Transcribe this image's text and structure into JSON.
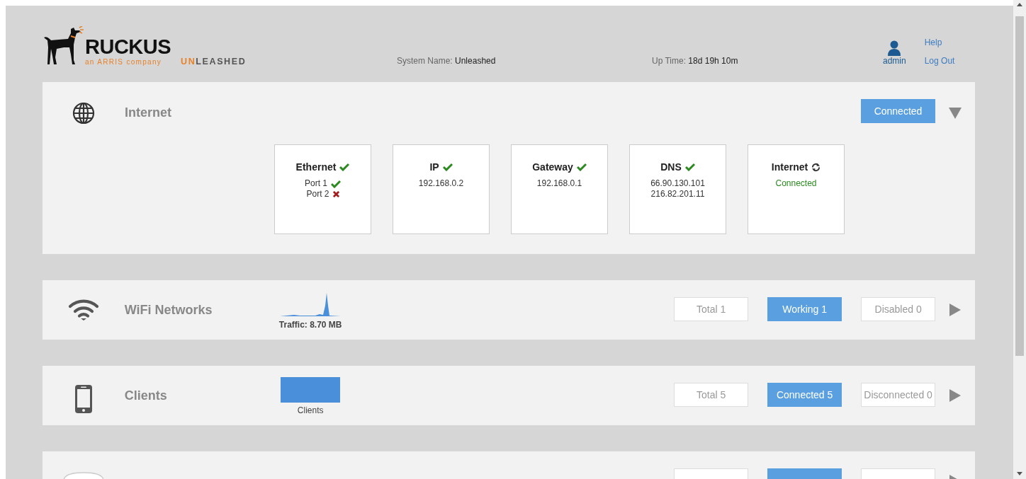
{
  "header": {
    "brand": "RUCKUS",
    "tagline": "an ARRIS company",
    "product_accent": "UN",
    "product_rest": "LEASHED",
    "system_name": {
      "label": "System Name:",
      "value": "Unleashed"
    },
    "uptime": {
      "label": "Up Time:",
      "value": "18d 19h 10m"
    },
    "user": "admin",
    "links": [
      "Help",
      "Log Out"
    ]
  },
  "panels": [
    {
      "kind": "internet",
      "title": "Internet",
      "expanded": true,
      "buttons": [
        {
          "label": "Connected",
          "selected": true
        }
      ],
      "cards": [
        {
          "title": "Ethernet",
          "kind": "check",
          "ok": true,
          "lines": [
            {
              "text": "Port 1",
              "kind": "port",
              "ok": true
            },
            {
              "text": "Port 2",
              "kind": "port",
              "ok": false
            }
          ]
        },
        {
          "title": "IP",
          "kind": "check",
          "ok": true,
          "lines": [
            {
              "text": "192.168.0.2",
              "kind": "value"
            }
          ]
        },
        {
          "title": "Gateway",
          "kind": "check",
          "ok": true,
          "lines": [
            {
              "text": "192.168.0.1",
              "kind": "value"
            }
          ]
        },
        {
          "title": "DNS",
          "kind": "check",
          "ok": true,
          "lines": [
            {
              "text": "66.90.130.101",
              "kind": "value"
            },
            {
              "text": "216.82.201.11",
              "kind": "value"
            }
          ]
        },
        {
          "title": "Internet",
          "kind": "refresh",
          "lines": [
            {
              "text": "Connected",
              "kind": "status"
            }
          ]
        }
      ]
    },
    {
      "kind": "wifi",
      "title": "WiFi Networks",
      "expanded": false,
      "preview": {
        "kind": "sparkline",
        "caption": "Traffic: 8.70 MB"
      },
      "buttons": [
        {
          "label": "Total 1",
          "selected": false
        },
        {
          "label": "Working 1",
          "selected": true
        },
        {
          "label": "Disabled 0",
          "selected": false
        }
      ]
    },
    {
      "kind": "clients",
      "title": "Clients",
      "expanded": false,
      "preview": {
        "kind": "block",
        "caption": "Clients"
      },
      "buttons": [
        {
          "label": "Total 5",
          "selected": false
        },
        {
          "label": "Connected 5",
          "selected": true
        },
        {
          "label": "Disconnected 0",
          "selected": false
        }
      ]
    },
    {
      "kind": "ap",
      "expanded": false,
      "buttons": [
        {
          "selected": false
        },
        {
          "selected": true
        },
        {
          "selected": false
        }
      ]
    }
  ]
}
